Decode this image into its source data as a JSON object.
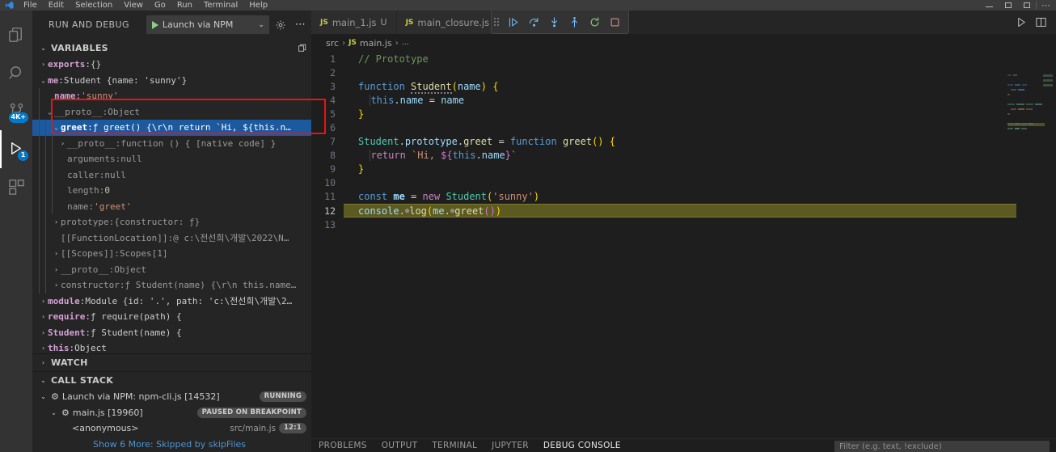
{
  "window": {
    "menus": [
      "File",
      "Edit",
      "Selection",
      "View",
      "Go",
      "Run",
      "Terminal",
      "Help"
    ],
    "controls": [
      "minimize",
      "maximize",
      "close"
    ]
  },
  "activity_bar": {
    "items": [
      {
        "name": "explorer",
        "icon": "files-icon",
        "badge": "",
        "active": false
      },
      {
        "name": "search",
        "icon": "search-icon",
        "badge": "",
        "active": false
      },
      {
        "name": "source-control",
        "icon": "source-control-icon",
        "badge": "4K+",
        "active": false
      },
      {
        "name": "run-and-debug",
        "icon": "run-debug-icon",
        "badge": "1",
        "active": true
      },
      {
        "name": "extensions",
        "icon": "extensions-icon",
        "badge": "",
        "active": false
      }
    ]
  },
  "sidebar": {
    "title": "RUN AND DEBUG",
    "launch_config": "Launch via NPM",
    "gear_icon": "gear-icon",
    "more_icon": "more-actions-icon",
    "sections": {
      "variables": {
        "title": "VARIABLES",
        "action_icon": "copy-icon"
      },
      "watch": {
        "title": "WATCH"
      },
      "call_stack": {
        "title": "CALL STACK"
      }
    },
    "variables": [
      {
        "indent": 1,
        "twisty": "collapsed",
        "name": "exports",
        "sep": ": ",
        "value": "{}",
        "bold": true,
        "dim": false,
        "selected": false
      },
      {
        "indent": 1,
        "twisty": "expanded",
        "name": "me",
        "sep": ": ",
        "value": "Student {name: 'sunny'}",
        "bold": true,
        "dim": false,
        "selected": false
      },
      {
        "indent": 2,
        "twisty": "none",
        "name": "name",
        "sep": ": ",
        "value": "'sunny'",
        "bold": true,
        "dim": false,
        "string": true,
        "selected": false
      },
      {
        "indent": 2,
        "twisty": "expanded",
        "name": "__proto__",
        "sep": ": ",
        "value": "Object",
        "bold": false,
        "dim": true,
        "selected": false
      },
      {
        "indent": 3,
        "twisty": "expanded",
        "name": "greet",
        "sep": ": ",
        "value": "ƒ greet() {\\r\\n  return `Hi, ${this.n…",
        "bold": true,
        "dim": false,
        "selected": true
      },
      {
        "indent": 4,
        "twisty": "collapsed",
        "name": "__proto__",
        "sep": ": ",
        "value": "function () { [native code] }",
        "bold": false,
        "dim": true,
        "selected": false
      },
      {
        "indent": 4,
        "twisty": "none",
        "name": "arguments",
        "sep": ": ",
        "value": "null",
        "bold": false,
        "dim": true,
        "selected": false
      },
      {
        "indent": 4,
        "twisty": "none",
        "name": "caller",
        "sep": ": ",
        "value": "null",
        "bold": false,
        "dim": true,
        "selected": false
      },
      {
        "indent": 4,
        "twisty": "none",
        "name": "length",
        "sep": ": ",
        "value": "0",
        "bold": false,
        "dim": true,
        "number": true,
        "selected": false
      },
      {
        "indent": 4,
        "twisty": "none",
        "name": "name",
        "sep": ": ",
        "value": "'greet'",
        "bold": false,
        "dim": true,
        "string": true,
        "selected": false
      },
      {
        "indent": 3,
        "twisty": "collapsed",
        "name": "prototype",
        "sep": ": ",
        "value": "{constructor: ƒ}",
        "bold": false,
        "dim": true,
        "selected": false
      },
      {
        "indent": 3,
        "twisty": "none",
        "name": "[[FunctionLocation]]",
        "sep": ": ",
        "value": "@ c:\\전선희\\개발\\2022\\N…",
        "bold": false,
        "dim": true,
        "selected": false
      },
      {
        "indent": 3,
        "twisty": "collapsed",
        "name": "[[Scopes]]",
        "sep": ": ",
        "value": "Scopes[1]",
        "bold": false,
        "dim": true,
        "selected": false
      },
      {
        "indent": 3,
        "twisty": "collapsed",
        "name": "__proto__",
        "sep": ": ",
        "value": "Object",
        "bold": false,
        "dim": true,
        "selected": false
      },
      {
        "indent": 3,
        "twisty": "collapsed",
        "name": "constructor",
        "sep": ": ",
        "value": "ƒ Student(name) {\\r\\n  this.name…",
        "bold": false,
        "dim": true,
        "selected": false
      },
      {
        "indent": 1,
        "twisty": "collapsed",
        "name": "module",
        "sep": ": ",
        "value": "Module {id: '.', path: 'c:\\전선희\\개발\\2…",
        "bold": true,
        "dim": false,
        "selected": false
      },
      {
        "indent": 1,
        "twisty": "collapsed",
        "name": "require",
        "sep": ": ",
        "value": "ƒ require(path) {",
        "bold": true,
        "dim": false,
        "selected": false
      },
      {
        "indent": 1,
        "twisty": "collapsed",
        "name": "Student",
        "sep": ": ",
        "value": "ƒ Student(name) {",
        "bold": true,
        "dim": false,
        "selected": false
      },
      {
        "indent": 1,
        "twisty": "collapsed",
        "name": "this",
        "sep": ": ",
        "value": "Object",
        "bold": true,
        "dim": false,
        "selected": false
      }
    ],
    "call_stack": [
      {
        "indent": 1,
        "twisty": "expanded",
        "icon": "debug-session-icon",
        "label": "Launch via NPM: npm-cli.js [14532]",
        "badge": "RUNNING",
        "sub": "",
        "line": ""
      },
      {
        "indent": 2,
        "twisty": "expanded",
        "icon": "debug-session-icon",
        "label": "main.js [19960]",
        "badge": "PAUSED ON BREAKPOINT",
        "sub": "",
        "line": ""
      },
      {
        "indent": 3,
        "twisty": "none",
        "icon": "",
        "label": "<anonymous>",
        "badge": "",
        "sub": "src/main.js",
        "line": "12:1"
      }
    ],
    "call_stack_more": "Show 6 More: Skipped by skipFiles"
  },
  "editor": {
    "tabs": [
      {
        "icon": "js-file-icon",
        "label": "main_1.js",
        "suffix": "U",
        "active": false
      },
      {
        "icon": "js-file-icon",
        "label": "main_closure.js",
        "suffix": "",
        "active": false
      }
    ],
    "tab_actions": [
      {
        "name": "run-file-button",
        "icon": "run-icon"
      },
      {
        "name": "split-editor-button",
        "icon": "split-editor-icon"
      }
    ],
    "debug_toolbar": [
      {
        "name": "drag-handle",
        "icon": "drag-handle-icon"
      },
      {
        "name": "continue-button",
        "icon": "continue-icon"
      },
      {
        "name": "step-over-button",
        "icon": "step-over-icon"
      },
      {
        "name": "step-into-button",
        "icon": "step-into-icon"
      },
      {
        "name": "step-out-button",
        "icon": "step-out-icon"
      },
      {
        "name": "restart-button",
        "icon": "restart-icon"
      },
      {
        "name": "stop-button",
        "icon": "stop-icon"
      }
    ],
    "breadcrumbs": [
      "src",
      "main.js",
      "…"
    ],
    "breadcrumb_file_icon": "js-file-icon",
    "current_line": 12,
    "breakpoint_line": 12,
    "lines": [
      {
        "n": 1,
        "text": "// Prototype"
      },
      {
        "n": 2,
        "text": ""
      },
      {
        "n": 3,
        "text": "function Student(name) {"
      },
      {
        "n": 4,
        "text": "  this.name = name"
      },
      {
        "n": 5,
        "text": "}"
      },
      {
        "n": 6,
        "text": ""
      },
      {
        "n": 7,
        "text": "Student.prototype.greet = function greet() {"
      },
      {
        "n": 8,
        "text": "  return `Hi, ${this.name}`"
      },
      {
        "n": 9,
        "text": "}"
      },
      {
        "n": 10,
        "text": ""
      },
      {
        "n": 11,
        "text": "const me = new Student('sunny')"
      },
      {
        "n": 12,
        "text": "console.log(me.greet())"
      },
      {
        "n": 13,
        "text": ""
      }
    ]
  },
  "panel": {
    "tabs": [
      "PROBLEMS",
      "OUTPUT",
      "TERMINAL",
      "JUPYTER",
      "DEBUG CONSOLE"
    ],
    "active_tab": "DEBUG CONSOLE",
    "filter_placeholder": "Filter (e.g. text, !exclude)"
  },
  "colors": {
    "accent": "#007acc",
    "selection": "#1b5a9e",
    "annotation": "#ee1111",
    "breakpoint": "#e51400",
    "current_line": "#5c5a20"
  }
}
